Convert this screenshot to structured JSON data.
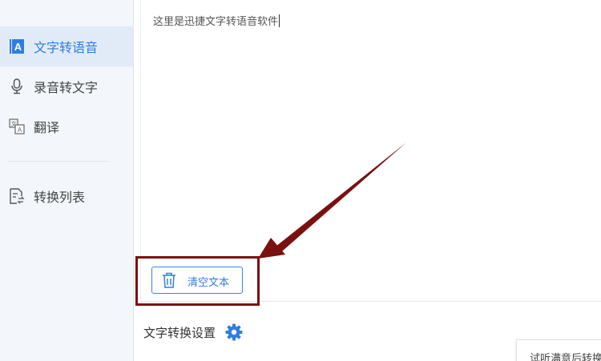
{
  "sidebar": {
    "items": [
      {
        "label": "文字转语音",
        "icon": "text-to-speech-icon",
        "active": true
      },
      {
        "label": "录音转文字",
        "icon": "microphone-icon",
        "active": false
      },
      {
        "label": "翻译",
        "icon": "translate-icon",
        "active": false
      },
      {
        "label": "转换列表",
        "icon": "conversion-list-icon",
        "active": false
      }
    ]
  },
  "editor": {
    "text": "这里是迅捷文字转语音软件"
  },
  "clear_button": {
    "label": "清空文本",
    "icon": "trash-icon"
  },
  "settings": {
    "title": "文字转换设置",
    "icon": "gear-icon"
  },
  "tooltip": {
    "text": "试听满意后转换"
  },
  "colors": {
    "accent": "#2f7de1",
    "active_bg": "#e1ebf8",
    "sidebar_bg": "#f3f6fa",
    "annotation": "#7a1010"
  }
}
